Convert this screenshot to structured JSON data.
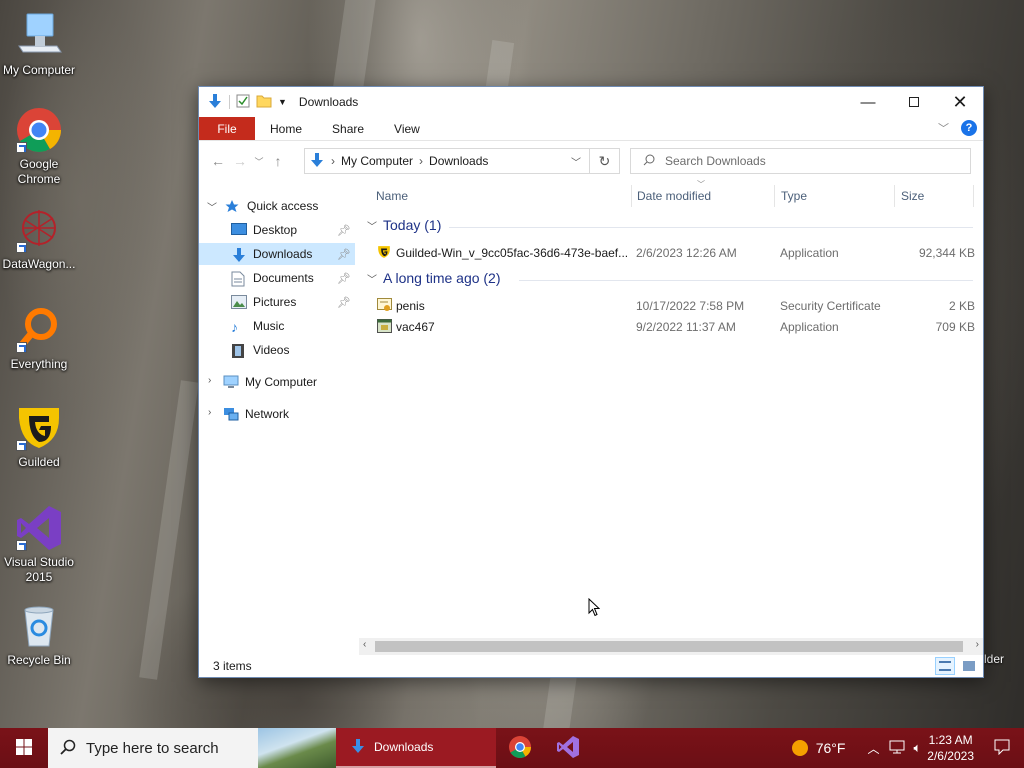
{
  "desktop": {
    "icons": [
      {
        "label": "My Computer"
      },
      {
        "label": "Google Chrome"
      },
      {
        "label": "DataWagon..."
      },
      {
        "label": "Everything"
      },
      {
        "label": "Guilded"
      },
      {
        "label": "Visual Studio 2015"
      },
      {
        "label": "Recycle Bin"
      }
    ],
    "partial_label": "lder"
  },
  "window": {
    "title": "Downloads",
    "ribbon_tabs": {
      "file": "File",
      "home": "Home",
      "share": "Share",
      "view": "View"
    },
    "breadcrumb": [
      "My Computer",
      "Downloads"
    ],
    "search_placeholder": "Search Downloads",
    "nav": {
      "quick_access": "Quick access",
      "items": [
        {
          "label": "Desktop",
          "pinned": true
        },
        {
          "label": "Downloads",
          "pinned": true
        },
        {
          "label": "Documents",
          "pinned": true
        },
        {
          "label": "Pictures",
          "pinned": true
        },
        {
          "label": "Music"
        },
        {
          "label": "Videos"
        }
      ],
      "my_computer": "My Computer",
      "network": "Network"
    },
    "columns": {
      "name": "Name",
      "date": "Date modified",
      "type": "Type",
      "size": "Size"
    },
    "groups": [
      {
        "label": "Today (1)",
        "files": [
          {
            "name": "Guilded-Win_v_9cc05fac-36d6-473e-baef...",
            "date": "2/6/2023 12:26 AM",
            "type": "Application",
            "size": "92,344 KB"
          }
        ]
      },
      {
        "label": "A long time ago (2)",
        "files": [
          {
            "name": "penis",
            "date": "10/17/2022 7:58 PM",
            "type": "Security Certificate",
            "size": "2 KB"
          },
          {
            "name": "vac467",
            "date": "9/2/2022 11:37 AM",
            "type": "Application",
            "size": "709 KB"
          }
        ]
      }
    ],
    "status": "3 items"
  },
  "taskbar": {
    "search_placeholder": "Type here to search",
    "active_app": "Downloads",
    "weather": "76°F",
    "time": "1:23 AM",
    "date": "2/6/2023"
  },
  "colors": {
    "taskbar": "#6b0f15",
    "file_tab": "#c42b1c",
    "selection": "#cce8ff",
    "group_header": "#1e3287"
  }
}
